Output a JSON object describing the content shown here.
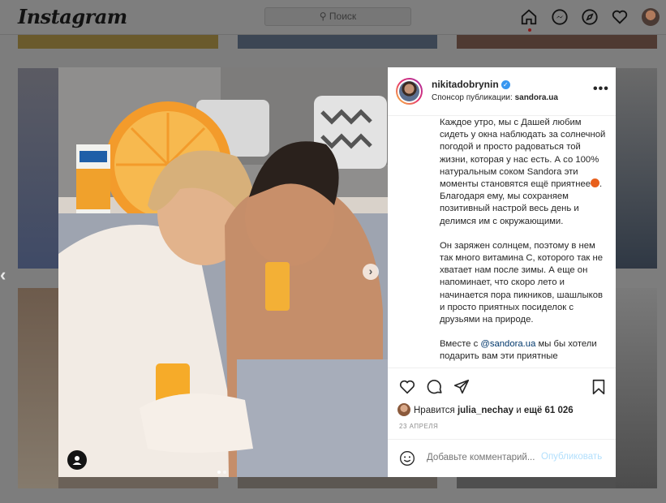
{
  "header": {
    "logo": "Instagram",
    "search_placeholder": "Поиск",
    "icons": [
      "home-icon",
      "messenger-icon",
      "explore-icon",
      "heart-icon",
      "profile-avatar"
    ]
  },
  "post": {
    "username": "nikitadobrynin",
    "verified": true,
    "sponsor_label": "Спонсор публикации:",
    "sponsor_name": "sandora.ua",
    "more": "•••",
    "caption_p1_a": "Каждое утро, мы с Дашей любим сидеть у окна наблюдать за солнечной погодой и просто радоваться той жизни, которая у нас есть. А со 100% натуральным соком Sandora эти моменты становятся ещё приятнее",
    "caption_p1_b": ". Благодаря ему, мы сохраняем позитивный настрой весь день и делимся им с окружающими.",
    "caption_p2": "Он заряжен солнцем, поэтому в нем так много витамина С, которого так не хватает нам после зимы. А еще он напоминает, что скоро лето и начинается пора пикников, шашлыков и просто приятных посиделок с друзьями на природе.",
    "caption_p3_a": "Вместе с ",
    "caption_p3_mention": "@sandora.ua",
    "caption_p3_b": " мы бы хотели подарить вам эти приятные",
    "likes_prefix": "Нравится ",
    "likes_user": "julia_nechay",
    "likes_and": " и ",
    "likes_more": "ещё 61 026",
    "date": "23 АПРЕЛЯ",
    "comment_placeholder": "Добавьте комментарий...",
    "post_button": "Опубликовать"
  },
  "colors": {
    "verified": "#3897f0",
    "post_button_disabled": "#b2dffc",
    "overlay_bg": "#7d7d7d"
  }
}
